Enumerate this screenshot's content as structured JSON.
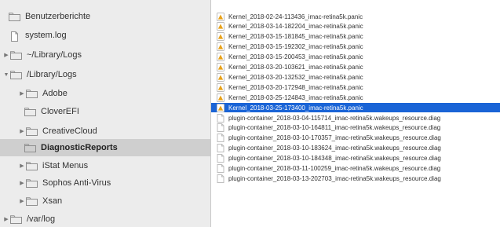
{
  "sidebar": {
    "items": [
      {
        "label": "Benutzerberichte",
        "icon": "folder-icon",
        "disclosure": "",
        "selected": false
      },
      {
        "label": "system.log",
        "icon": "document-icon",
        "disclosure": "",
        "selected": false
      },
      {
        "label": "~/Library/Logs",
        "icon": "folder-icon",
        "disclosure": "▶",
        "selected": false
      },
      {
        "label": "/Library/Logs",
        "icon": "folder-icon",
        "disclosure": "▼",
        "selected": false
      },
      {
        "label": "Adobe",
        "icon": "folder-icon",
        "disclosure": "▶",
        "selected": false
      },
      {
        "label": "CloverEFI",
        "icon": "folder-icon",
        "disclosure": "",
        "selected": false
      },
      {
        "label": "CreativeCloud",
        "icon": "folder-icon",
        "disclosure": "▶",
        "selected": false
      },
      {
        "label": "DiagnosticReports",
        "icon": "folder-icon",
        "disclosure": "",
        "selected": true
      },
      {
        "label": "iStat Menus",
        "icon": "folder-icon",
        "disclosure": "▶",
        "selected": false
      },
      {
        "label": "Sophos Anti-Virus",
        "icon": "folder-icon",
        "disclosure": "▶",
        "selected": false
      },
      {
        "label": "Xsan",
        "icon": "folder-icon",
        "disclosure": "▶",
        "selected": false
      },
      {
        "label": "/var/log",
        "icon": "folder-icon",
        "disclosure": "▶",
        "selected": false
      }
    ]
  },
  "files": {
    "items": [
      {
        "name": "Kernel_2018-02-24-113436_imac-retina5k.panic",
        "type": "panic",
        "selected": false
      },
      {
        "name": "Kernel_2018-03-14-182204_imac-retina5k.panic",
        "type": "panic",
        "selected": false
      },
      {
        "name": "Kernel_2018-03-15-181845_imac-retina5k.panic",
        "type": "panic",
        "selected": false
      },
      {
        "name": "Kernel_2018-03-15-192302_imac-retina5k.panic",
        "type": "panic",
        "selected": false
      },
      {
        "name": "Kernel_2018-03-15-200453_imac-retina5k.panic",
        "type": "panic",
        "selected": false
      },
      {
        "name": "Kernel_2018-03-20-103621_imac-retina5k.panic",
        "type": "panic",
        "selected": false
      },
      {
        "name": "Kernel_2018-03-20-132532_imac-retina5k.panic",
        "type": "panic",
        "selected": false
      },
      {
        "name": "Kernel_2018-03-20-172948_imac-retina5k.panic",
        "type": "panic",
        "selected": false
      },
      {
        "name": "Kernel_2018-03-25-124843_imac-retina5k.panic",
        "type": "panic",
        "selected": false
      },
      {
        "name": "Kernel_2018-03-25-173400_imac-retina5k.panic",
        "type": "panic",
        "selected": true
      },
      {
        "name": "plugin-container_2018-03-04-115714_imac-retina5k.wakeups_resource.diag",
        "type": "diag",
        "selected": false
      },
      {
        "name": "plugin-container_2018-03-10-164811_imac-retina5k.wakeups_resource.diag",
        "type": "diag",
        "selected": false
      },
      {
        "name": "plugin-container_2018-03-10-170357_imac-retina5k.wakeups_resource.diag",
        "type": "diag",
        "selected": false
      },
      {
        "name": "plugin-container_2018-03-10-183624_imac-retina5k.wakeups_resource.diag",
        "type": "diag",
        "selected": false
      },
      {
        "name": "plugin-container_2018-03-10-184348_imac-retina5k.wakeups_resource.diag",
        "type": "diag",
        "selected": false
      },
      {
        "name": "plugin-container_2018-03-11-100259_imac-retina5k.wakeups_resource.diag",
        "type": "diag",
        "selected": false
      },
      {
        "name": "plugin-container_2018-03-13-202703_imac-retina5k.wakeups_resource.diag",
        "type": "diag",
        "selected": false
      }
    ]
  },
  "colors": {
    "sidebar_bg": "#ececec",
    "sidebar_selected": "#cfcfcf",
    "file_selected": "#1a64d6",
    "folder_icon": "#8f8f8f",
    "panic_icon": "#e8a21a"
  }
}
